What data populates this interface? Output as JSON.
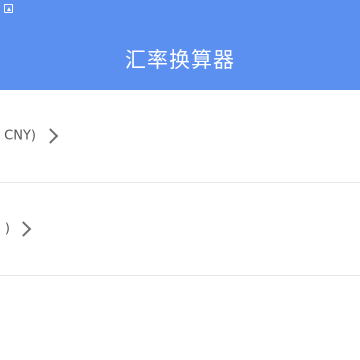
{
  "header": {
    "title": "汇率换算器",
    "status_icon": "notification-icon"
  },
  "list": {
    "items": [
      {
        "label": "CNY)",
        "icon": "chevron-right-icon"
      },
      {
        "label": ")",
        "icon": "chevron-right-icon"
      }
    ]
  },
  "colors": {
    "header_bg": "#5b8ff0",
    "divider": "#e6e6e6"
  }
}
